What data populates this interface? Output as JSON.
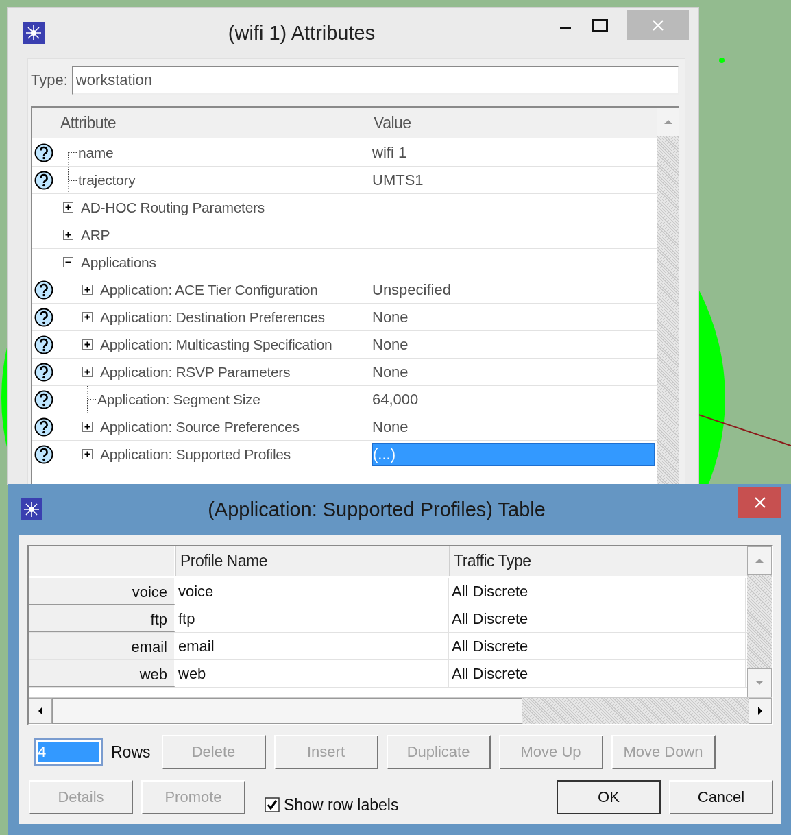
{
  "attributes_window": {
    "title": "(wifi 1) Attributes",
    "type_label": "Type:",
    "type_value": "workstation",
    "columns": [
      "Attribute",
      "Value"
    ],
    "rows": [
      {
        "kind": "leaf",
        "help": true,
        "label": "name",
        "value": "wifi 1",
        "selected": false
      },
      {
        "kind": "leaf",
        "help": true,
        "label": "trajectory",
        "value": "UMTS1",
        "selected": false
      },
      {
        "kind": "group",
        "help": false,
        "label": "AD-HOC Routing Parameters",
        "expanded": false
      },
      {
        "kind": "group",
        "help": false,
        "label": "ARP",
        "expanded": false
      },
      {
        "kind": "group",
        "help": false,
        "label": "Applications",
        "expanded": true,
        "children": [
          {
            "kind": "group",
            "help": true,
            "label": "Application: ACE Tier Configuration",
            "value": "Unspecified",
            "expanded": false,
            "selected": false
          },
          {
            "kind": "group",
            "help": true,
            "label": "Application: Destination Preferences",
            "value": "None",
            "expanded": false,
            "selected": false
          },
          {
            "kind": "group",
            "help": true,
            "label": "Application: Multicasting Specification",
            "value": "None",
            "expanded": false,
            "selected": false
          },
          {
            "kind": "group",
            "help": true,
            "label": "Application: RSVP Parameters",
            "value": "None",
            "expanded": false,
            "selected": false
          },
          {
            "kind": "leaf",
            "help": true,
            "label": "Application: Segment Size",
            "value": "64,000",
            "selected": false
          },
          {
            "kind": "group",
            "help": true,
            "label": "Application: Source Preferences",
            "value": "None",
            "expanded": false,
            "selected": false
          },
          {
            "kind": "group",
            "help": true,
            "label": "Application: Supported Profiles",
            "value": "(...)",
            "expanded": false,
            "selected": true
          }
        ]
      }
    ]
  },
  "table_window": {
    "title": "(Application: Supported Profiles) Table",
    "columns": [
      "Profile Name",
      "Traffic Type"
    ],
    "rows": [
      {
        "row_label": "voice",
        "cells": [
          "voice",
          "All Discrete"
        ]
      },
      {
        "row_label": "ftp",
        "cells": [
          "ftp",
          "All Discrete"
        ]
      },
      {
        "row_label": "email",
        "cells": [
          "email",
          "All Discrete"
        ]
      },
      {
        "row_label": "web",
        "cells": [
          "web",
          "All Discrete"
        ]
      }
    ],
    "rows_field": {
      "value": "4",
      "label": "Rows"
    },
    "row_buttons": [
      {
        "label": "Delete",
        "disabled": true
      },
      {
        "label": "Insert",
        "disabled": true
      },
      {
        "label": "Duplicate",
        "disabled": true
      },
      {
        "label": "Move Up",
        "disabled": true
      },
      {
        "label": "Move Down",
        "disabled": true
      }
    ],
    "left_buttons": [
      {
        "label": "Details",
        "disabled": true
      },
      {
        "label": "Promote",
        "disabled": true
      }
    ],
    "show_row_labels": {
      "label": "Show row labels",
      "checked": true
    },
    "dialog_buttons": [
      {
        "label": "OK",
        "disabled": false,
        "default": true
      },
      {
        "label": "Cancel",
        "disabled": false,
        "default": false
      }
    ]
  }
}
